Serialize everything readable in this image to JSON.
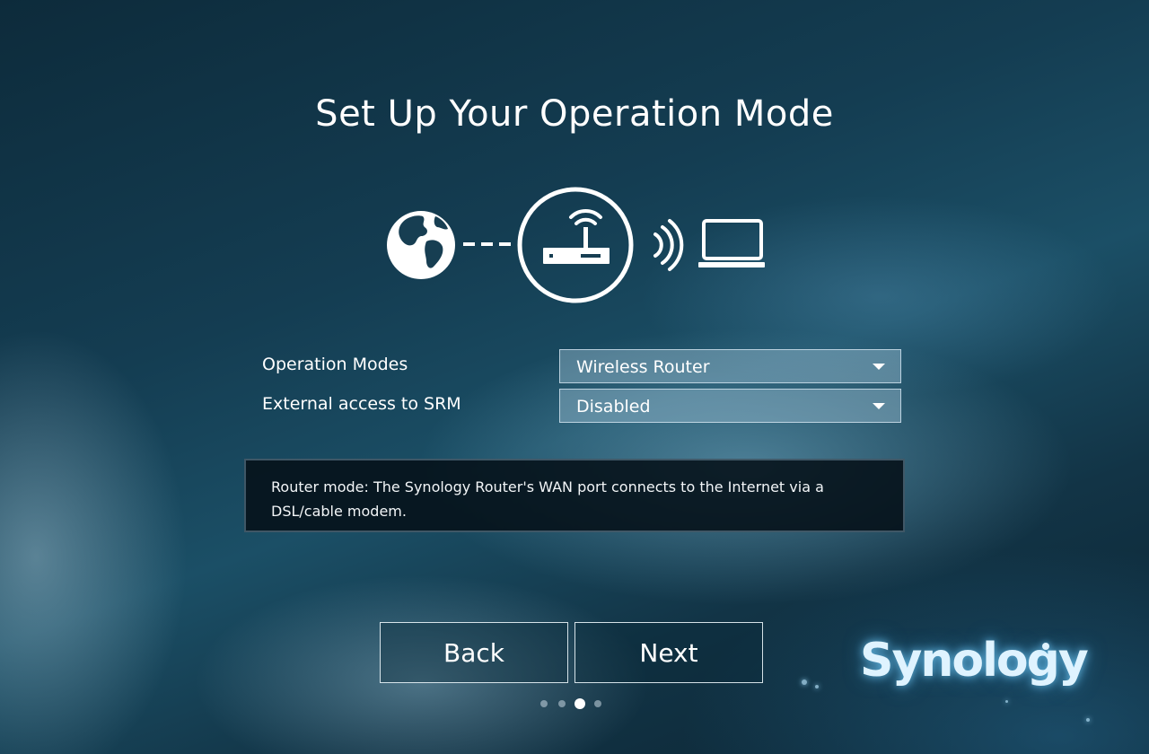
{
  "page": {
    "title": "Set Up Your Operation Mode"
  },
  "diagram": {
    "icons": [
      "globe-icon",
      "router-icon",
      "wifi-signal-icon",
      "laptop-icon"
    ]
  },
  "form": {
    "operation_modes": {
      "label": "Operation Modes",
      "value": "Wireless Router"
    },
    "external_access": {
      "label": "External access to SRM",
      "value": "Disabled"
    }
  },
  "info": {
    "line1": "Router mode: The Synology Router's WAN port connects to the Internet via a",
    "line2": "DSL/cable modem."
  },
  "buttons": {
    "back": "Back",
    "next": "Next"
  },
  "pagination": {
    "total": 4,
    "current": 3
  },
  "brand": {
    "logo_text": "Synology",
    "accent": "#dff3ff"
  }
}
